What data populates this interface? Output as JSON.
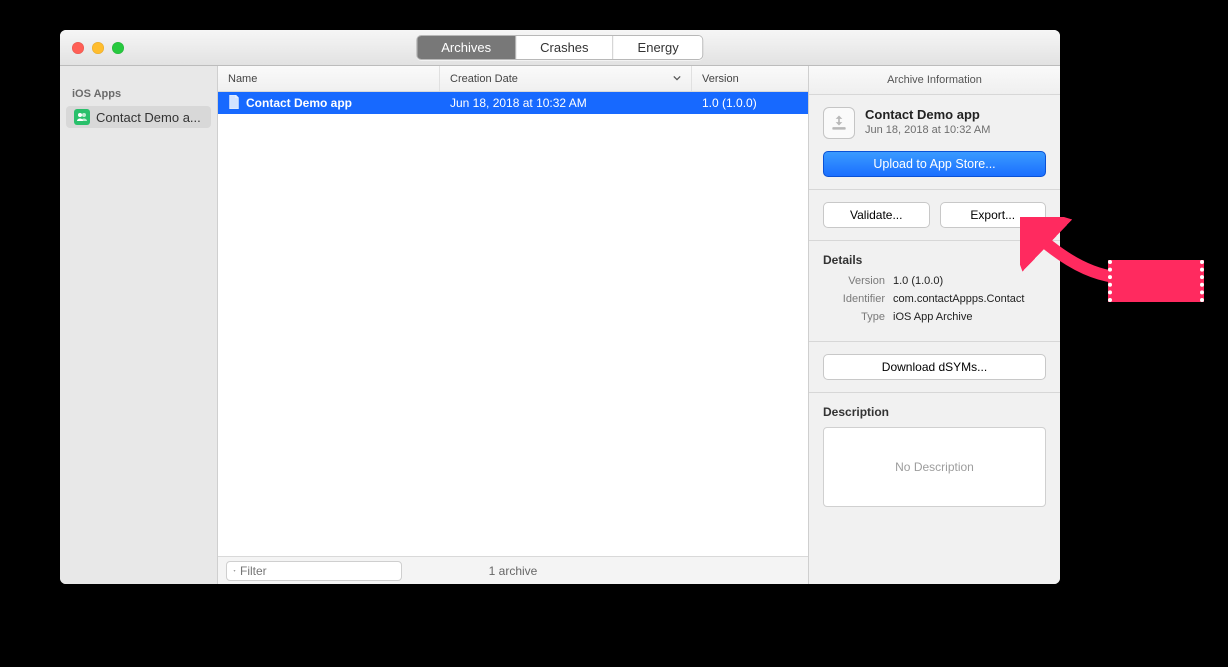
{
  "tabs": {
    "archives": "Archives",
    "crashes": "Crashes",
    "energy": "Energy"
  },
  "sidebar": {
    "heading": "iOS Apps",
    "items": [
      {
        "label": "Contact Demo a..."
      }
    ]
  },
  "columns": {
    "name": "Name",
    "date": "Creation Date",
    "version": "Version"
  },
  "rows": [
    {
      "name": "Contact Demo app",
      "date": "Jun 18, 2018 at 10:32 AM",
      "version": "1.0 (1.0.0)"
    }
  ],
  "footer": {
    "filter_placeholder": "Filter",
    "count_text": "1 archive"
  },
  "info": {
    "header": "Archive Information",
    "app_name": "Contact Demo app",
    "app_date": "Jun 18, 2018 at 10:32 AM",
    "upload_label": "Upload to App Store...",
    "validate_label": "Validate...",
    "export_label": "Export...",
    "details_label": "Details",
    "version_label": "Version",
    "version_value": "1.0 (1.0.0)",
    "identifier_label": "Identifier",
    "identifier_value": "com.contactAppps.Contact",
    "type_label": "Type",
    "type_value": "iOS App Archive",
    "dsyms_label": "Download dSYMs...",
    "description_label": "Description",
    "description_placeholder": "No Description"
  }
}
